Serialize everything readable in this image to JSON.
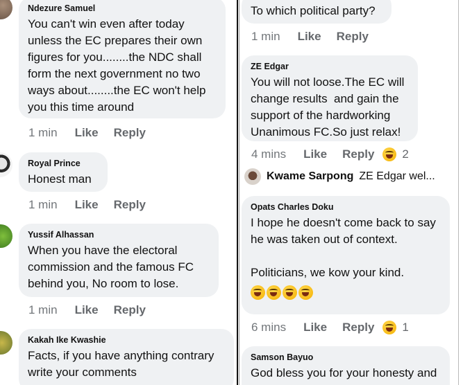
{
  "left": {
    "comments": [
      {
        "name": "Ndezure Samuel",
        "text": "You can't win even after today\nunless the EC prepares their own\nfigures for you........the NDC shall\nform the next government no two\nways about........the EC won't help\nyou this time around",
        "time": "1 min",
        "like": "Like",
        "reply": "Reply"
      },
      {
        "name": "Royal Prince",
        "text": "Honest man",
        "time": "1 min",
        "like": "Like",
        "reply": "Reply"
      },
      {
        "name": "Yussif Alhassan",
        "text": "When you have the electoral\ncommission and the famous FC\nbehind you, No room to lose.",
        "time": "1 min",
        "like": "Like",
        "reply": "Reply"
      },
      {
        "name": "Kakah Ike Kwashie",
        "text": "Facts, if you have anything contrary\nwrite your comments"
      }
    ]
  },
  "right": {
    "top_text": "To which political party?",
    "top_meta": {
      "time": "1 min",
      "like": "Like",
      "reply": "Reply"
    },
    "comments": [
      {
        "name": "ZE Edgar",
        "text": "You will not loose.The EC will\nchange results  and gain the\nsupport of the hardworking\nUnanimous FC.So just relax!",
        "time": "4 mins",
        "like": "Like",
        "reply": "Reply",
        "reactions": "2"
      },
      {
        "name": "Opats Charles Doku",
        "text": "I hope he doesn't come back to say\nhe was taken out of context.\n\nPoliticians, we kow your kind.",
        "time": "6 mins",
        "like": "Like",
        "reply": "Reply",
        "reactions": "1"
      },
      {
        "name": "Samson Bayuo",
        "text": "God bless you for your honesty and\nTruth"
      }
    ],
    "reply_preview": {
      "name": "Kwame Sarpong",
      "text": "ZE Edgar  wel..."
    }
  },
  "colors": {
    "bubble": "#eff1f3",
    "meta": "#65686c"
  }
}
